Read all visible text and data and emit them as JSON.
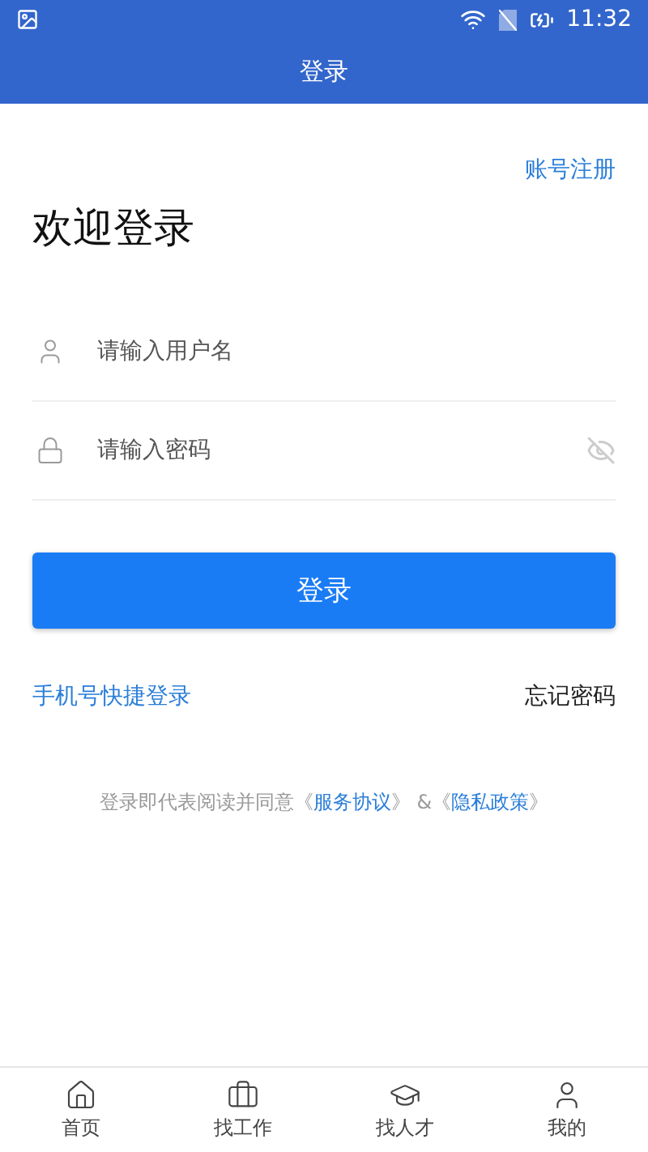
{
  "status_bar": {
    "time": "11:32"
  },
  "app_bar": {
    "title": "登录"
  },
  "register_link": "账号注册",
  "heading": "欢迎登录",
  "fields": [
    {
      "kind": "user",
      "placeholder": "请输入用户名"
    },
    {
      "kind": "password",
      "placeholder": "请输入密码",
      "password_visible": false
    }
  ],
  "login_button": "登录",
  "phone_login_link": "手机号快捷登录",
  "forgot_password_link": "忘记密码",
  "agreement": {
    "text": "登录即代表阅读并同意",
    "open": "《",
    "close": "》",
    "joiner": " &",
    "links": [
      "服务协议",
      "隐私政策"
    ]
  },
  "bottom_nav": [
    {
      "kind": "home",
      "label": "首页"
    },
    {
      "kind": "briefcase",
      "label": "找工作"
    },
    {
      "kind": "cap",
      "label": "找人才"
    },
    {
      "kind": "person",
      "label": "我的"
    }
  ]
}
